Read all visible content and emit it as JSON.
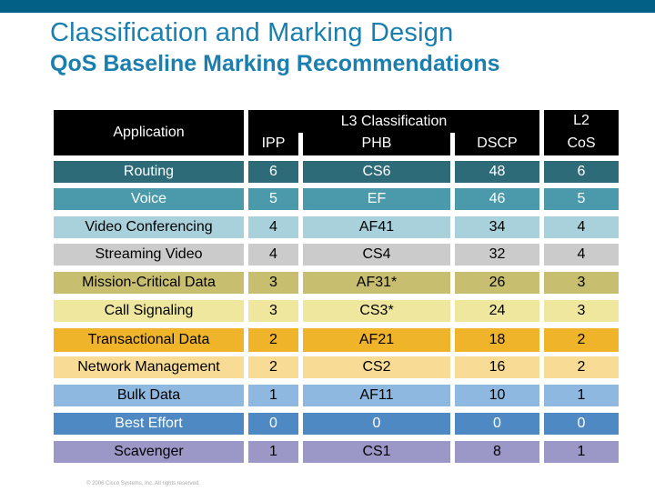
{
  "slide": {
    "title": "Classification and Marking Design",
    "subtitle": "QoS Baseline Marking Recommendations",
    "copyright": "© 2006 Cisco Systems, Inc. All rights reserved."
  },
  "colors": {
    "top_bar": "#025f86",
    "title": "#1a7fae",
    "header_bg": "#000000"
  },
  "table": {
    "headers": {
      "application": "Application",
      "l3_group": "L3 Classification",
      "ipp": "IPP",
      "phb": "PHB",
      "dscp": "DSCP",
      "l2_line1": "L2",
      "l2_line2": "CoS"
    },
    "rows": [
      {
        "application": "Routing",
        "ipp": "6",
        "phb": "CS6",
        "dscp": "48",
        "cos": "6",
        "bg": "#2e6b78",
        "fg": "#ffffff"
      },
      {
        "application": "Voice",
        "ipp": "5",
        "phb": "EF",
        "dscp": "46",
        "cos": "5",
        "bg": "#4b9aab",
        "fg": "#ffffff"
      },
      {
        "application": "Video Conferencing",
        "ipp": "4",
        "phb": "AF41",
        "dscp": "34",
        "cos": "4",
        "bg": "#a9d1dc",
        "fg": "#000000"
      },
      {
        "application": "Streaming Video",
        "ipp": "4",
        "phb": "CS4",
        "dscp": "32",
        "cos": "4",
        "bg": "#cbcbcb",
        "fg": "#000000"
      },
      {
        "application": "Mission-Critical Data",
        "ipp": "3",
        "phb": "AF31*",
        "dscp": "26",
        "cos": "3",
        "bg": "#c8be6f",
        "fg": "#000000"
      },
      {
        "application": "Call Signaling",
        "ipp": "3",
        "phb": "CS3*",
        "dscp": "24",
        "cos": "3",
        "bg": "#eee79d",
        "fg": "#000000"
      },
      {
        "application": "Transactional Data",
        "ipp": "2",
        "phb": "AF21",
        "dscp": "18",
        "cos": "2",
        "bg": "#f0b42a",
        "fg": "#000000"
      },
      {
        "application": "Network Management",
        "ipp": "2",
        "phb": "CS2",
        "dscp": "16",
        "cos": "2",
        "bg": "#f8dc96",
        "fg": "#000000"
      },
      {
        "application": "Bulk Data",
        "ipp": "1",
        "phb": "AF11",
        "dscp": "10",
        "cos": "1",
        "bg": "#8fb8e1",
        "fg": "#000000"
      },
      {
        "application": "Best Effort",
        "ipp": "0",
        "phb": "0",
        "dscp": "0",
        "cos": "0",
        "bg": "#4f89c4",
        "fg": "#ffffff"
      },
      {
        "application": "Scavenger",
        "ipp": "1",
        "phb": "CS1",
        "dscp": "8",
        "cos": "1",
        "bg": "#9b98c8",
        "fg": "#000000"
      }
    ]
  }
}
